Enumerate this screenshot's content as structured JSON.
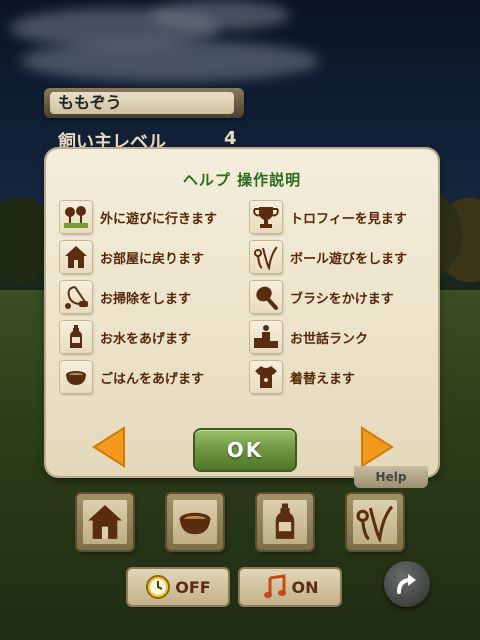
{
  "hud": {
    "pet_name": "ももぞう",
    "level_label": "飼い主レベル",
    "level_value": "4",
    "help_tab": "Help"
  },
  "dialog": {
    "title": "ヘルプ 操作説明",
    "items": [
      {
        "icon": "trees-icon",
        "label": "外に遊びに行きます"
      },
      {
        "icon": "trophy-icon",
        "label": "トロフィーを見ます"
      },
      {
        "icon": "house-icon",
        "label": "お部屋に戻ります"
      },
      {
        "icon": "ball-play-icon",
        "label": "ボール遊びをします"
      },
      {
        "icon": "vacuum-icon",
        "label": "お掃除をします"
      },
      {
        "icon": "brush-icon",
        "label": "ブラシをかけます"
      },
      {
        "icon": "water-bottle-icon",
        "label": "お水をあげます"
      },
      {
        "icon": "podium-icon",
        "label": "お世話ランク"
      },
      {
        "icon": "food-bowl-icon",
        "label": "ごはんをあげます"
      },
      {
        "icon": "clothes-icon",
        "label": "着替えます"
      }
    ],
    "ok_label": "OK"
  },
  "bottom": {
    "clock_toggle": "OFF",
    "music_toggle": "ON"
  },
  "colors": {
    "title_green": "#2b6b1e",
    "label_brown": "#55280a",
    "arrow_orange": "#f39a1e",
    "ok_green": "#6e9640",
    "icon_brown": "#5a2c10"
  }
}
